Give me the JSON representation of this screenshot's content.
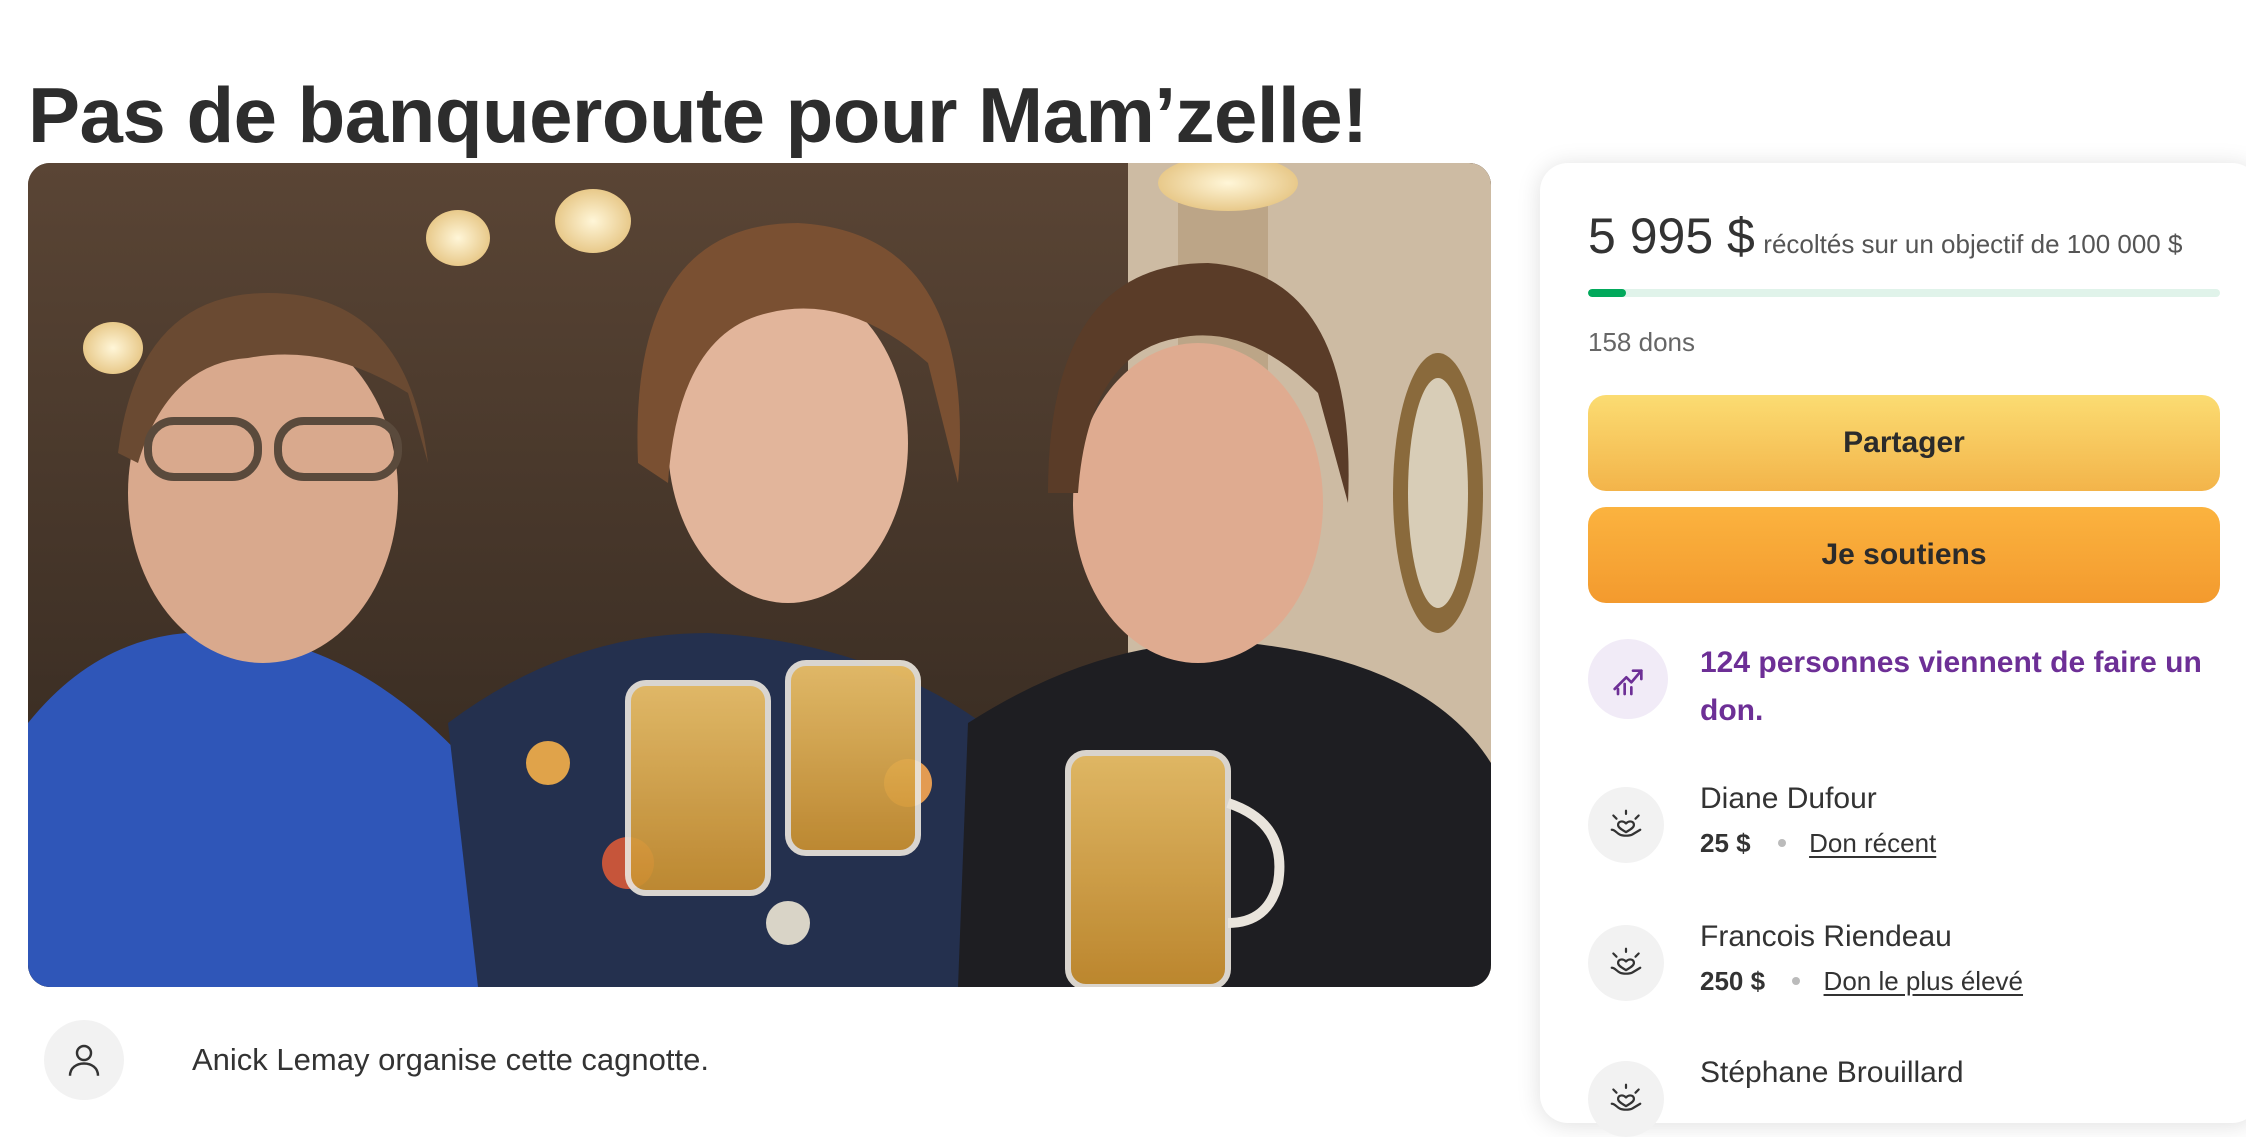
{
  "page": {
    "title": "Pas de banqueroute pour Mam’zelle!"
  },
  "hero": {
    "image_icon": "photo-three-women-toasting-beer"
  },
  "organizer": {
    "text": "Anick Lemay organise cette cagnotte.",
    "icon": "user-icon"
  },
  "summary": {
    "amount": "5 995 $",
    "goal_text": "récoltés sur un objectif de 100 000 $",
    "progress_fraction": 0.05995,
    "donation_count": "158 dons",
    "colors": {
      "progress": "#02a95c",
      "progress_track": "#e0f3ea"
    }
  },
  "buttons": {
    "share_label": "Partager",
    "donate_label": "Je soutiens"
  },
  "trend": {
    "text": "124 personnes viennent de faire un don.",
    "icon": "trending-up-icon",
    "color": "#6d2f96"
  },
  "donations": [
    {
      "name": "Diane Dufour",
      "amount": "25 $",
      "tag": "Don récent",
      "icon": "heart-hand-icon"
    },
    {
      "name": "Francois Riendeau",
      "amount": "250 $",
      "tag": "Don le plus élevé",
      "icon": "heart-hand-icon"
    },
    {
      "name": "Stéphane Brouillard",
      "amount": "",
      "tag": "",
      "icon": "heart-hand-icon"
    }
  ]
}
